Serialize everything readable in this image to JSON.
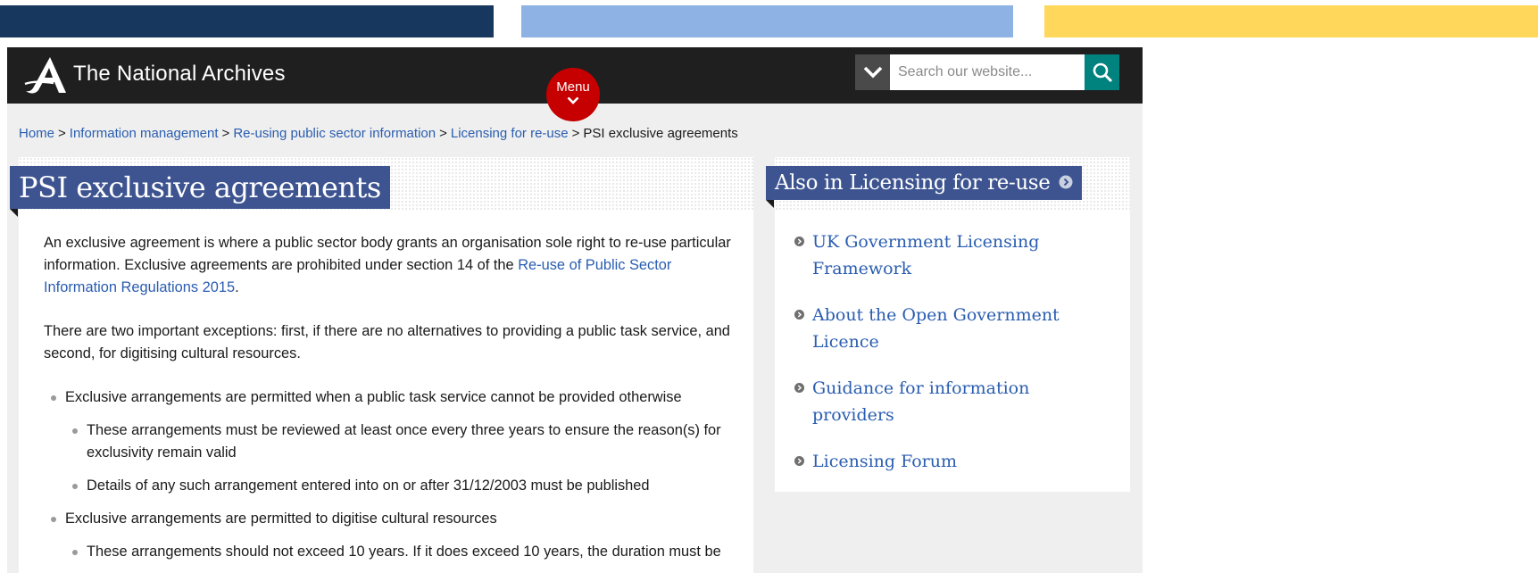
{
  "colors": {
    "accent_bar_1": "#17375e",
    "accent_bar_2": "#8db2e3",
    "accent_bar_3": "#ffd75a",
    "header_bg": "#1f1f1f",
    "menu_red": "#c60000",
    "search_teal": "#00827f",
    "title_blue": "#3d5490",
    "link_blue": "#2a5db0"
  },
  "header": {
    "logo_icon": "national-archives-logo-icon",
    "site_name": "The National Archives",
    "menu_label": "Menu",
    "search": {
      "placeholder": "Search our website...",
      "value": "",
      "dropdown_icon": "chevron-down-icon",
      "button_icon": "search-icon"
    }
  },
  "breadcrumb": {
    "items": [
      "Home",
      "Information management",
      "Re-using public sector information",
      "Licensing for re-use"
    ],
    "current": "PSI exclusive agreements",
    "separator": ">"
  },
  "main": {
    "title": "PSI exclusive agreements",
    "para1_text": "An exclusive agreement is where a public sector body grants an organisation sole right to re-use particular information. Exclusive agreements are prohibited under section 14 of the ",
    "para1_link": "Re-use of Public Sector Information Regulations 2015",
    "para1_end": ".",
    "para2": "There are two important exceptions: first, if there are no alternatives to providing a public task service, and second, for digitising cultural resources.",
    "list": [
      {
        "text": "Exclusive arrangements are permitted when a public task service cannot be provided otherwise",
        "sub": [
          "These arrangements must be reviewed at least once every three years to ensure the reason(s) for exclusivity remain valid",
          "Details of any such arrangement entered into on or after 31/12/2003 must be published"
        ]
      },
      {
        "text": "Exclusive arrangements are permitted to digitise cultural resources",
        "sub": [
          "These arrangements should not exceed 10 years. If it does exceed 10 years, the duration must be"
        ]
      }
    ]
  },
  "sidebar": {
    "title": "Also in Licensing for re-use",
    "title_icon": "chevron-right-circle-icon",
    "links": [
      "UK Government Licensing Framework",
      "About the Open Government Licence",
      "Guidance for information providers",
      "Licensing Forum"
    ]
  }
}
